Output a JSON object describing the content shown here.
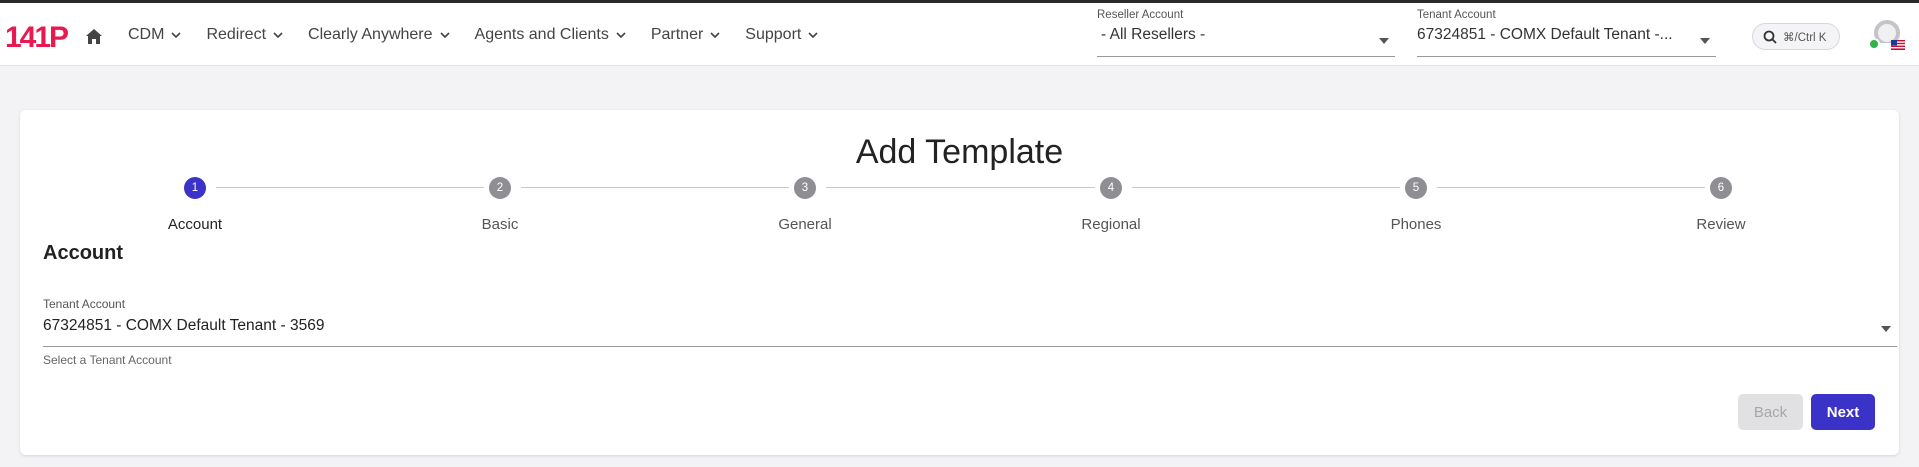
{
  "app": {
    "logo_text": "141P",
    "brand_color": "#e8194f",
    "accent_color": "#3b32c8"
  },
  "nav": {
    "home_icon": "home-icon",
    "items": [
      {
        "label": "CDM"
      },
      {
        "label": "Redirect"
      },
      {
        "label": "Clearly Anywhere"
      },
      {
        "label": "Agents and Clients"
      },
      {
        "label": "Partner"
      },
      {
        "label": "Support"
      }
    ]
  },
  "reseller": {
    "label": "Reseller Account",
    "value": "-  All Resellers -"
  },
  "tenant_header": {
    "label": "Tenant Account",
    "value": "67324851 - COMX Default Tenant -..."
  },
  "search": {
    "shortcut": "⌘/Ctrl K"
  },
  "page": {
    "title": "Add Template",
    "steps": [
      {
        "number": "1",
        "label": "Account",
        "active": true
      },
      {
        "number": "2",
        "label": "Basic",
        "active": false
      },
      {
        "number": "3",
        "label": "General",
        "active": false
      },
      {
        "number": "4",
        "label": "Regional",
        "active": false
      },
      {
        "number": "5",
        "label": "Phones",
        "active": false
      },
      {
        "number": "6",
        "label": "Review",
        "active": false
      }
    ],
    "section_title": "Account",
    "tenant_field": {
      "label": "Tenant Account",
      "value": "67324851 - COMX Default Tenant - 3569",
      "helper": "Select a Tenant Account"
    },
    "buttons": {
      "back": "Back",
      "next": "Next"
    }
  }
}
